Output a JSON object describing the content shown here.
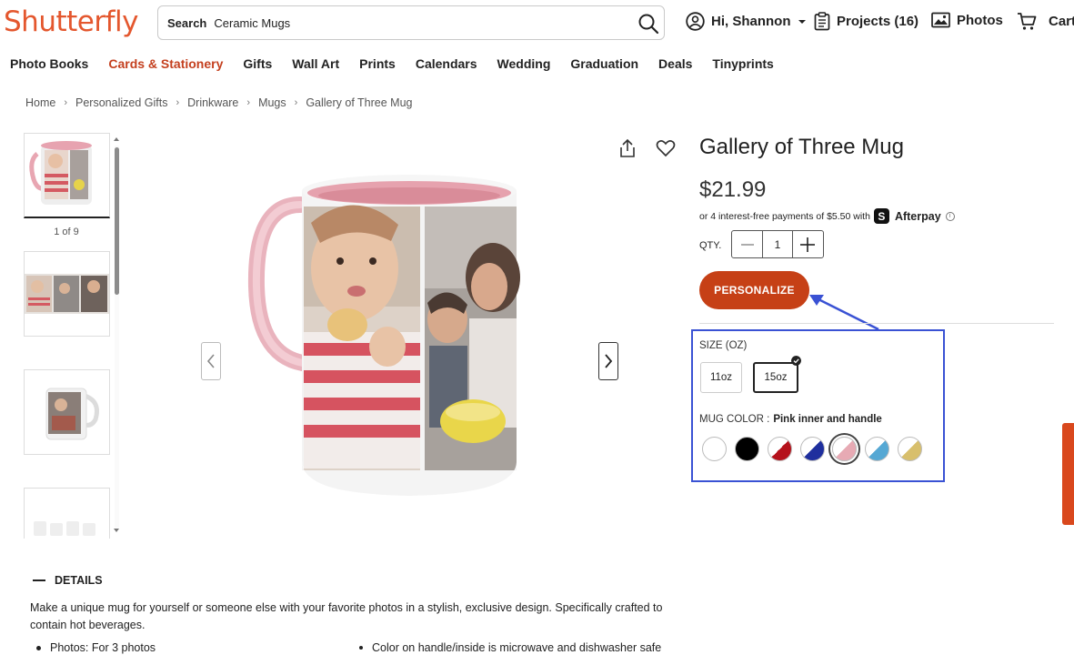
{
  "header": {
    "logo": "Shutterfly",
    "search_label": "Search",
    "search_value": "Ceramic Mugs",
    "account": "Hi, Shannon",
    "projects": "Projects (16)",
    "photos": "Photos",
    "cart": "Cart"
  },
  "nav": [
    "Photo Books",
    "Cards & Stationery",
    "Gifts",
    "Wall Art",
    "Prints",
    "Calendars",
    "Wedding",
    "Graduation",
    "Deals",
    "Tinyprints"
  ],
  "breadcrumb": [
    "Home",
    "Personalized Gifts",
    "Drinkware",
    "Mugs",
    "Gallery of Three Mug"
  ],
  "gallery": {
    "counter": "1 of 9"
  },
  "product": {
    "title": "Gallery of Three Mug",
    "price": "$21.99",
    "afterpay_text": "or 4 interest-free payments of $5.50 with",
    "afterpay_brand": "Afterpay",
    "qty_label": "QTY.",
    "qty": "1",
    "personalize": "PERSONALIZE",
    "size_label": "SIZE (OZ)",
    "sizes": [
      "11oz",
      "15oz"
    ],
    "selected_size": "15oz",
    "color_label": "MUG COLOR :",
    "color_value": "Pink inner and handle",
    "colors": [
      "#ffffff",
      "#000000",
      "#b5121b",
      "#1f2f9e",
      "#e7aab4",
      "#56a8d4",
      "#d8bf6c"
    ],
    "selected_color_index": 4
  },
  "details": {
    "heading": "DETAILS",
    "text": "Make a unique mug for yourself or someone else with your favorite photos in a stylish, exclusive design. Specifically crafted to contain hot beverages.",
    "bullets": [
      "Photos: For 3 photos",
      "Color on handle/inside is microwave and dishwasher safe"
    ]
  },
  "colors": {
    "brand": "#e4572e",
    "accent": "#c64016",
    "highlight": "#3a52d4"
  }
}
